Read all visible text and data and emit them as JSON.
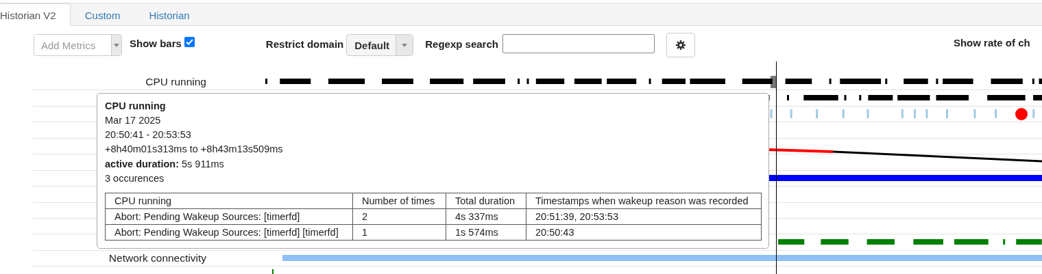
{
  "tabs": [
    {
      "label": "Historian V2",
      "selected": true
    },
    {
      "label": "Custom",
      "selected": false
    },
    {
      "label": "Historian",
      "selected": false
    }
  ],
  "toolbar": {
    "add_metrics": {
      "placeholder": "Add Metrics",
      "disabled": true
    },
    "show_bars": {
      "label": "Show bars",
      "checked": true
    },
    "restrict_domain": {
      "label": "Restrict domain",
      "value": "Default"
    },
    "regexp_search": {
      "label": "Regexp search"
    },
    "show_rate": {
      "label": "Show rate of ch"
    }
  },
  "rows": [
    {
      "label": "CPU running",
      "kind": "dense",
      "color": "#000000"
    },
    {
      "kind": "dense",
      "color": "#000000"
    },
    {
      "kind": "ticks",
      "color": "#9ecae1",
      "highlight": true
    },
    {
      "kind": "empty"
    },
    {
      "kind": "empty"
    },
    {
      "kind": "empty"
    },
    {
      "kind": "bar",
      "color": "#0000ff"
    },
    {
      "kind": "empty"
    },
    {
      "kind": "empty"
    },
    {
      "kind": "empty"
    },
    {
      "kind": "blocks",
      "color": "#008000"
    },
    {
      "label": "Network connectivity",
      "kind": "bar",
      "color": "#8fc0f5"
    },
    {
      "kind": "single",
      "color": "#008000"
    }
  ],
  "tooltip": {
    "title": "CPU running",
    "lines": [
      "Mar 17 2025",
      "20:50:41 - 20:53:53",
      "+8h40m01s313ms to +8h43m13s509ms",
      "**active duration:** 5s 911ms",
      "3 occurences"
    ],
    "table": {
      "columns": [
        "CPU running",
        "Number of times",
        "Total duration",
        "Timestamps when wakeup reason was recorded"
      ],
      "rows": [
        [
          "Abort: Pending Wakeup Sources: [timerfd]",
          "2",
          "4s 337ms",
          "20:51:39, 20:53:53"
        ],
        [
          "Abort: Pending Wakeup Sources: [timerfd] [timerfd]",
          "1",
          "1s 574ms",
          "20:50:43"
        ]
      ]
    }
  }
}
